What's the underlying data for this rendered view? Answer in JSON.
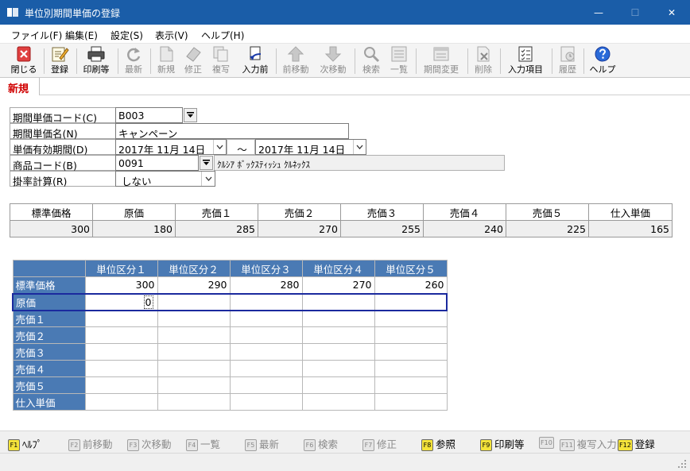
{
  "window": {
    "title": "単位別期間単価の登録",
    "minimize_glyph": "—",
    "maximize_glyph": "☐",
    "close_glyph": "✕"
  },
  "menu": [
    {
      "id": "file",
      "label": "ファイル(F)"
    },
    {
      "id": "edit",
      "label": "編集(E)"
    },
    {
      "id": "settings",
      "label": "設定(S)"
    },
    {
      "id": "view",
      "label": "表示(V)"
    },
    {
      "id": "help",
      "label": "ヘルプ(H)"
    }
  ],
  "toolbar": {
    "close": "閉じる",
    "register": "登録",
    "print": "印刷等",
    "latest": "最新",
    "new": "新規",
    "modify": "修正",
    "copy": "複写",
    "before_input": "入力前",
    "prev": "前移動",
    "next": "次移動",
    "search": "検索",
    "list": "一覧",
    "period_change": "期間変更",
    "delete": "削除",
    "input_items": "入力項目",
    "history": "履歴",
    "help": "ヘルプ"
  },
  "mode_tab": "新規",
  "form": {
    "code_label": "期間単価コード(C)",
    "code_value": "B003",
    "name_label": "期間単価名(N)",
    "name_value": "キャンペーン",
    "period_label": "単価有効期間(D)",
    "period_from": "2017年  11月  14日",
    "period_sep": "～",
    "period_to": "2017年  11月  14日",
    "product_label": "商品コード(B)",
    "product_code": "0091",
    "product_name": "ｸﾙｼｱ ﾎﾞｯｸｽﾃｨｯｼｭ ｸﾙﾈｯｸｽ",
    "rate_label": "掛率計算(R)",
    "rate_value": "しない"
  },
  "price_table": {
    "headers": [
      "標準価格",
      "原価",
      "売価１",
      "売価２",
      "売価３",
      "売価４",
      "売価５",
      "仕入単価"
    ],
    "values": [
      "300",
      "180",
      "285",
      "270",
      "255",
      "240",
      "225",
      "165"
    ]
  },
  "grid": {
    "columns": [
      "単位区分１",
      "単位区分２",
      "単位区分３",
      "単位区分４",
      "単位区分５"
    ],
    "rows": [
      {
        "label": "標準価格",
        "cells": [
          "300",
          "290",
          "280",
          "270",
          "260"
        ]
      },
      {
        "label": "原価",
        "cells": [
          "0",
          "",
          "",
          "",
          ""
        ]
      },
      {
        "label": "売価１",
        "cells": [
          "",
          "",
          "",
          "",
          ""
        ]
      },
      {
        "label": "売価２",
        "cells": [
          "",
          "",
          "",
          "",
          ""
        ]
      },
      {
        "label": "売価３",
        "cells": [
          "",
          "",
          "",
          "",
          ""
        ]
      },
      {
        "label": "売価４",
        "cells": [
          "",
          "",
          "",
          "",
          ""
        ]
      },
      {
        "label": "売価５",
        "cells": [
          "",
          "",
          "",
          "",
          ""
        ]
      },
      {
        "label": "仕入単価",
        "cells": [
          "",
          "",
          "",
          "",
          ""
        ]
      }
    ]
  },
  "fkeys": [
    {
      "key": "F1",
      "label": "ﾍﾙﾌﾟ"
    },
    {
      "key": "F2",
      "label": "前移動"
    },
    {
      "key": "F3",
      "label": "次移動"
    },
    {
      "key": "F4",
      "label": "一覧"
    },
    {
      "key": "F5",
      "label": "最新"
    },
    {
      "key": "F6",
      "label": "検索"
    },
    {
      "key": "F7",
      "label": "修正"
    },
    {
      "key": "F8",
      "label": "参照"
    },
    {
      "key": "F9",
      "label": "印刷等"
    },
    {
      "key": "F10",
      "label": ""
    },
    {
      "key": "F11",
      "label": "複写入力"
    },
    {
      "key": "F12",
      "label": "登録"
    }
  ],
  "colors": {
    "titlebar": "#1a5da8",
    "grid_header": "#4a7ab4",
    "mode_tab_text": "#d00000",
    "fkey_active": "#f4e33a"
  }
}
